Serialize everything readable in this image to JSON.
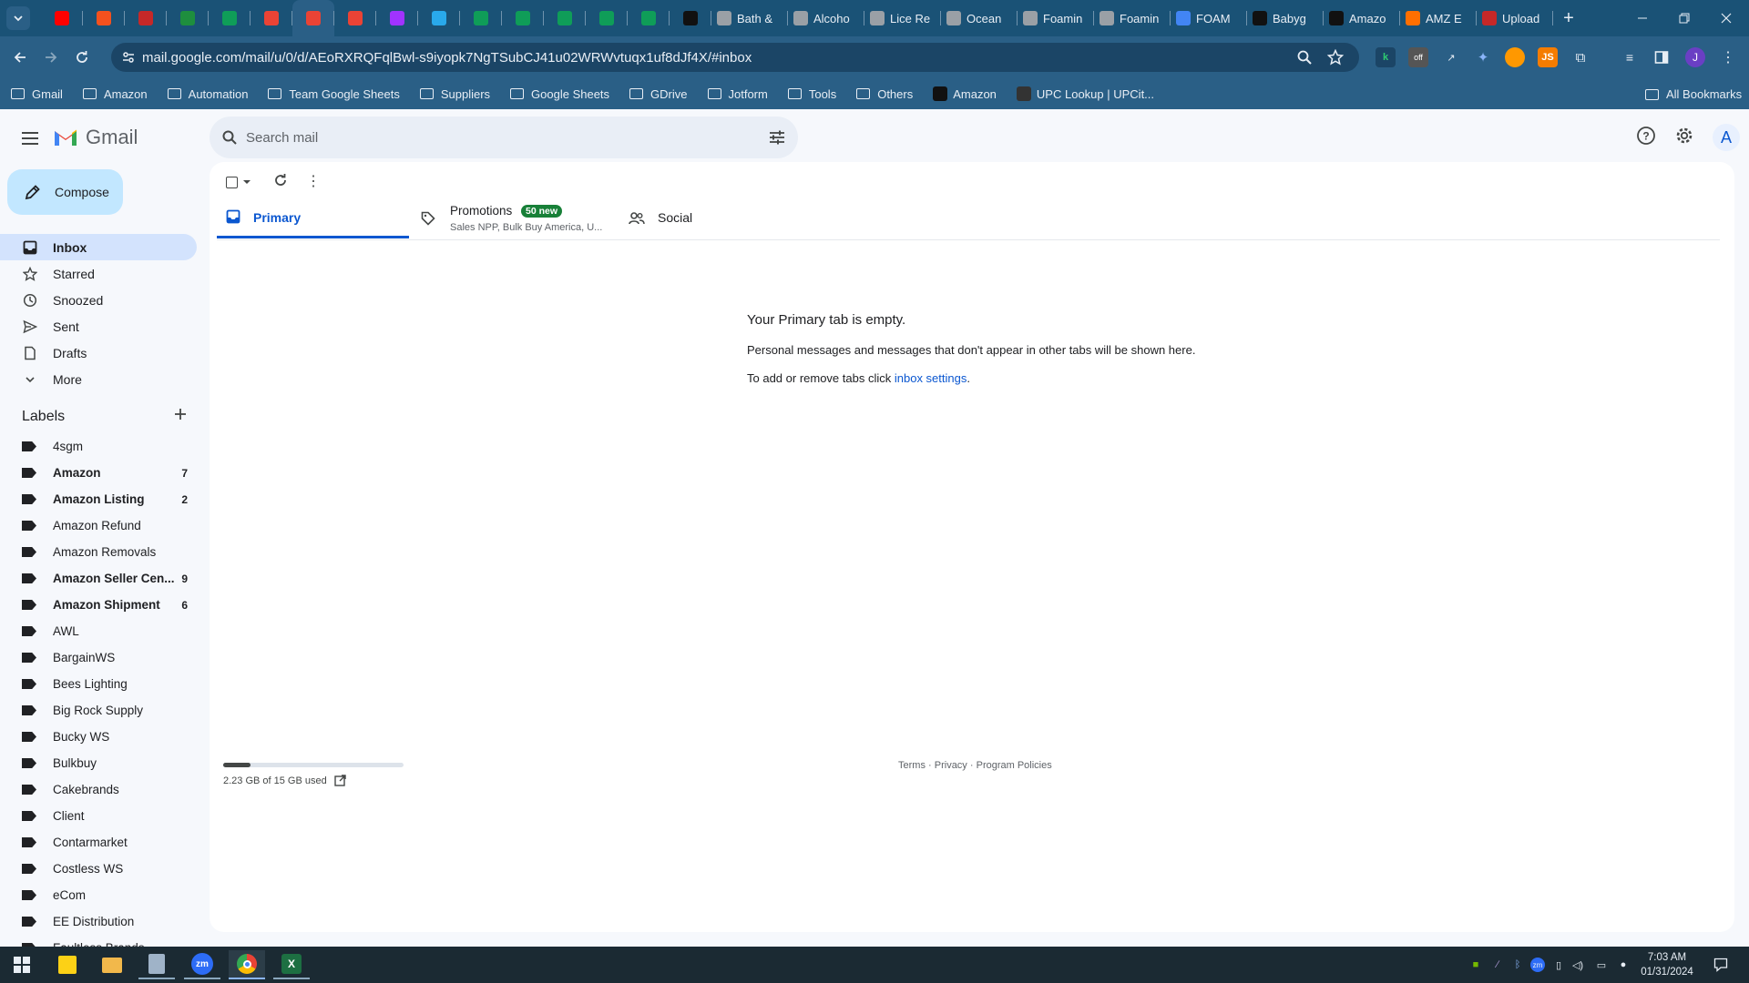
{
  "browser": {
    "tabs": [
      {
        "title": "",
        "favicon": "youtube",
        "color": "#ff0000"
      },
      {
        "title": "",
        "favicon": "app-orange",
        "color": "#f4511e"
      },
      {
        "title": "",
        "favicon": "shield-red",
        "color": "#c62828"
      },
      {
        "title": "",
        "favicon": "sheets-alt",
        "color": "#1e8e3e"
      },
      {
        "title": "",
        "favicon": "sheets",
        "color": "#0f9d58"
      },
      {
        "title": "",
        "favicon": "gmail",
        "color": "#ea4335"
      },
      {
        "title": "",
        "favicon": "gmail",
        "color": "#ea4335",
        "active": true
      },
      {
        "title": "",
        "favicon": "gmail",
        "color": "#ea4335"
      },
      {
        "title": "",
        "favicon": "messenger",
        "color": "#a033ff"
      },
      {
        "title": "",
        "favicon": "telegram",
        "color": "#29a9eb"
      },
      {
        "title": "",
        "favicon": "sheets",
        "color": "#0f9d58"
      },
      {
        "title": "",
        "favicon": "sheets",
        "color": "#0f9d58"
      },
      {
        "title": "",
        "favicon": "sheets",
        "color": "#0f9d58"
      },
      {
        "title": "",
        "favicon": "sheets",
        "color": "#0f9d58"
      },
      {
        "title": "",
        "favicon": "sheets",
        "color": "#0f9d58"
      },
      {
        "title": "",
        "favicon": "amazon",
        "color": "#111111"
      },
      {
        "title": "Bath &",
        "favicon": "globe",
        "color": "#9aa0a6"
      },
      {
        "title": "Alcoho",
        "favicon": "globe",
        "color": "#9aa0a6"
      },
      {
        "title": "Lice Re",
        "favicon": "globe",
        "color": "#9aa0a6"
      },
      {
        "title": "Ocean",
        "favicon": "globe",
        "color": "#9aa0a6"
      },
      {
        "title": "Foamin",
        "favicon": "globe",
        "color": "#9aa0a6"
      },
      {
        "title": "Foamin",
        "favicon": "globe",
        "color": "#9aa0a6"
      },
      {
        "title": "FOAM",
        "favicon": "google",
        "color": "#4285f4"
      },
      {
        "title": "Babyg",
        "favicon": "amazon",
        "color": "#111111"
      },
      {
        "title": "Amazo",
        "favicon": "amazon",
        "color": "#111111"
      },
      {
        "title": "AMZ E",
        "favicon": "amz-tool",
        "color": "#ff6f00"
      },
      {
        "title": "Upload",
        "favicon": "shield-red",
        "color": "#c62828"
      }
    ],
    "new_tab": "+",
    "url": "mail.google.com/mail/u/0/d/AEoRXRQFqlBwl-s9iyopk7NgTSubCJ41u02WRWvtuqx1uf8dJf4X/#inbox",
    "extensions": [
      "keepa",
      "off-toggle",
      "arrow",
      "puzzle-blue",
      "firefox-like",
      "js",
      "puzzle",
      "media",
      "sidepanel"
    ],
    "profile_initial": "J",
    "bookmarks": [
      {
        "label": "Gmail",
        "type": "folder"
      },
      {
        "label": "Amazon",
        "type": "folder"
      },
      {
        "label": "Automation",
        "type": "folder"
      },
      {
        "label": "Team Google Sheets",
        "type": "folder"
      },
      {
        "label": "Suppliers",
        "type": "folder"
      },
      {
        "label": "Google Sheets",
        "type": "folder"
      },
      {
        "label": "GDrive",
        "type": "folder"
      },
      {
        "label": "Jotform",
        "type": "folder"
      },
      {
        "label": "Tools",
        "type": "folder"
      },
      {
        "label": "Others",
        "type": "folder"
      },
      {
        "label": "Amazon",
        "type": "amazon"
      },
      {
        "label": "UPC Lookup | UPCit...",
        "type": "upc"
      }
    ],
    "all_bookmarks": "All Bookmarks"
  },
  "gmail": {
    "logo_text": "Gmail",
    "search_placeholder": "Search mail",
    "compose": "Compose",
    "nav": [
      {
        "label": "Inbox",
        "icon": "inbox-icon",
        "active": true
      },
      {
        "label": "Starred",
        "icon": "star-icon"
      },
      {
        "label": "Snoozed",
        "icon": "clock-icon"
      },
      {
        "label": "Sent",
        "icon": "send-icon"
      },
      {
        "label": "Drafts",
        "icon": "draft-icon"
      },
      {
        "label": "More",
        "icon": "chevron-down-icon"
      }
    ],
    "labels_heading": "Labels",
    "labels": [
      {
        "name": "4sgm",
        "count": "",
        "bold": false
      },
      {
        "name": "Amazon",
        "count": "7",
        "bold": true
      },
      {
        "name": "Amazon Listing",
        "count": "2",
        "bold": true
      },
      {
        "name": "Amazon Refund",
        "count": "",
        "bold": false
      },
      {
        "name": "Amazon Removals",
        "count": "",
        "bold": false
      },
      {
        "name": "Amazon Seller Cen...",
        "count": "9",
        "bold": true
      },
      {
        "name": "Amazon Shipment",
        "count": "6",
        "bold": true
      },
      {
        "name": "AWL",
        "count": "",
        "bold": false
      },
      {
        "name": "BargainWS",
        "count": "",
        "bold": false
      },
      {
        "name": "Bees Lighting",
        "count": "",
        "bold": false
      },
      {
        "name": "Big Rock Supply",
        "count": "",
        "bold": false
      },
      {
        "name": "Bucky WS",
        "count": "",
        "bold": false
      },
      {
        "name": "Bulkbuy",
        "count": "",
        "bold": false
      },
      {
        "name": "Cakebrands",
        "count": "",
        "bold": false
      },
      {
        "name": "Client",
        "count": "",
        "bold": false
      },
      {
        "name": "Contarmarket",
        "count": "",
        "bold": false
      },
      {
        "name": "Costless WS",
        "count": "",
        "bold": false
      },
      {
        "name": "eCom",
        "count": "",
        "bold": false
      },
      {
        "name": "EE Distribution",
        "count": "",
        "bold": false
      },
      {
        "name": "Faultless Brands",
        "count": "",
        "bold": false
      }
    ],
    "tabs": [
      {
        "label": "Primary",
        "icon": "inbox-icon",
        "active": true
      },
      {
        "label": "Promotions",
        "icon": "tag-icon",
        "badge": "50 new",
        "sub": "Sales NPP, Bulk Buy America, U..."
      },
      {
        "label": "Social",
        "icon": "people-icon"
      }
    ],
    "empty": {
      "title": "Your Primary tab is empty.",
      "line1": "Personal messages and messages that don't appear in other tabs will be shown here.",
      "line2_prefix": "To add or remove tabs click ",
      "line2_link": "inbox settings",
      "line2_suffix": "."
    },
    "storage": {
      "text": "2.23 GB of 15 GB used",
      "fraction": 0.149
    },
    "footer": {
      "terms": "Terms",
      "privacy": "Privacy",
      "policies": "Program Policies",
      "sep": "·"
    },
    "account_initial": "A"
  },
  "taskbar": {
    "apps": [
      "windows-start",
      "sticky-notes",
      "file-explorer",
      "calculator",
      "zoom",
      "chrome",
      "excel"
    ],
    "time": "7:03 AM",
    "date": "01/31/2024"
  },
  "colors": {
    "tabstrip": "#1a5276",
    "toolbar": "#2a5f86",
    "gmail_bg": "#f6f8fc",
    "active_nav": "#d3e3fd",
    "compose": "#c2e7ff",
    "primary_blue": "#0b57d0",
    "promo_badge": "#188038"
  }
}
